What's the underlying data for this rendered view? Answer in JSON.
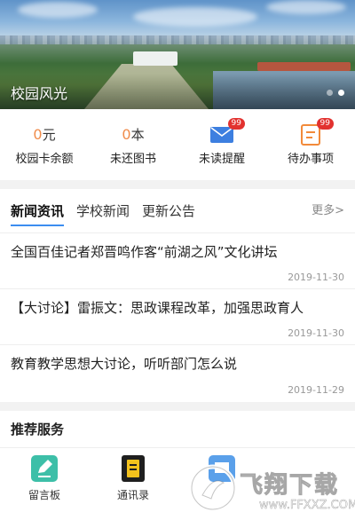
{
  "banner": {
    "title": "校园风光",
    "slide_count": 2,
    "active_slide": 1
  },
  "stats": [
    {
      "value": "0",
      "unit": "元",
      "label": "校园卡余额",
      "kind": "text"
    },
    {
      "value": "0",
      "unit": "本",
      "label": "未还图书",
      "kind": "text"
    },
    {
      "icon": "mail-icon",
      "badge": "99",
      "label": "未读提醒",
      "kind": "icon"
    },
    {
      "icon": "todo-icon",
      "badge": "99",
      "label": "待办事项",
      "kind": "icon"
    }
  ],
  "news": {
    "tabs": [
      {
        "label": "新闻资讯",
        "active": true
      },
      {
        "label": "学校新闻",
        "active": false
      },
      {
        "label": "更新公告",
        "active": false
      }
    ],
    "more": "更多>",
    "items": [
      {
        "title": "全国百佳记者郑晋鸣作客“前湖之风”文化讲坛",
        "date": "2019-11-30"
      },
      {
        "title": "【大讨论】雷振文：思政课程改革，加强思政育人",
        "date": "2019-11-30"
      },
      {
        "title": "教育教学思想大讨论，听听部门怎么说",
        "date": "2019-11-29"
      }
    ]
  },
  "services": {
    "heading": "推荐服务",
    "items": [
      {
        "label": "留言板",
        "icon": "message-board-icon"
      },
      {
        "label": "通讯录",
        "icon": "contacts-icon"
      },
      {
        "label": "",
        "icon": "service-icon"
      }
    ]
  },
  "watermark": {
    "text": "飞翔下载",
    "url": "www.FFXXZ.COM"
  },
  "colors": {
    "accent": "#3c8df0",
    "stat_number": "#f08c4b",
    "badge": "#e2322f",
    "mail": "#3d7fe0",
    "todo": "#f28a3a"
  }
}
